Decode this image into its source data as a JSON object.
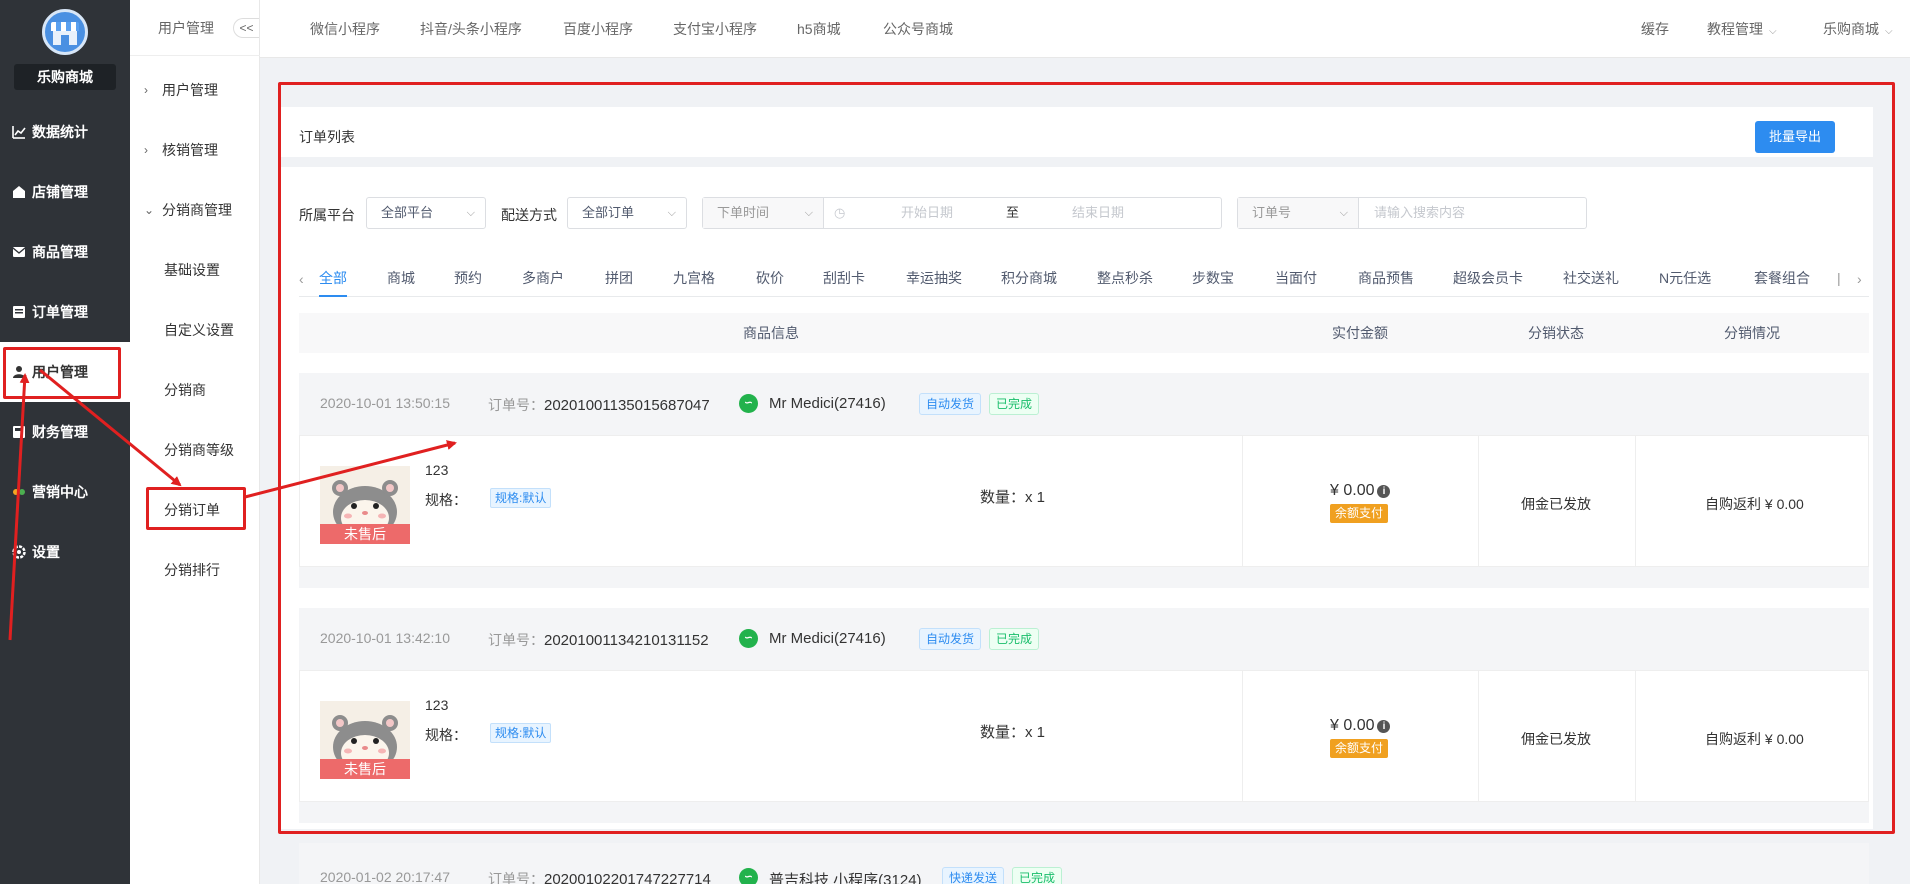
{
  "app": {
    "name": "乐购商城"
  },
  "sidebar": {
    "items": [
      {
        "label": "数据统计",
        "icon": "chart-icon"
      },
      {
        "label": "店铺管理",
        "icon": "store-icon"
      },
      {
        "label": "商品管理",
        "icon": "goods-icon"
      },
      {
        "label": "订单管理",
        "icon": "order-icon"
      },
      {
        "label": "用户管理",
        "icon": "user-icon"
      },
      {
        "label": "财务管理",
        "icon": "finance-icon"
      },
      {
        "label": "营销中心",
        "icon": "marketing-icon"
      },
      {
        "label": "设置",
        "icon": "gear-icon"
      }
    ]
  },
  "subsidebar": {
    "title": "用户管理",
    "collapse": "<<",
    "items": [
      "用户管理",
      "核销管理",
      "分销商管理",
      "基础设置",
      "自定义设置",
      "分销商",
      "分销商等级",
      "分销订单",
      "分销排行"
    ]
  },
  "topnav": {
    "tabs": [
      "微信小程序",
      "抖音/头条小程序",
      "百度小程序",
      "支付宝小程序",
      "h5商城",
      "公众号商城"
    ],
    "right": [
      "缓存",
      "教程管理",
      "乐购商城"
    ]
  },
  "card": {
    "title": "订单列表",
    "export": "批量导出"
  },
  "filters": {
    "platform_label": "所属平台",
    "platform_value": "全部平台",
    "delivery_label": "配送方式",
    "delivery_value": "全部订单",
    "time_type": "下单时间",
    "start_placeholder": "开始日期",
    "to": "至",
    "end_placeholder": "结束日期",
    "search_type": "订单号",
    "search_placeholder": "请输入搜索内容"
  },
  "tabs": [
    "全部",
    "商城",
    "预约",
    "多商户",
    "拼团",
    "九宫格",
    "砍价",
    "刮刮卡",
    "幸运抽奖",
    "积分商城",
    "整点秒杀",
    "步数宝",
    "当面付",
    "商品预售",
    "超级会员卡",
    "社交送礼",
    "N元任选",
    "套餐组合",
    "|"
  ],
  "table": {
    "headers": [
      "商品信息",
      "实付金额",
      "分销状态",
      "分销情况"
    ]
  },
  "orders": [
    {
      "time": "2020-10-01 13:50:15",
      "order_no_label": "订单号：",
      "order_no": "2020100113501568704",
      "order_no_tail": "7",
      "user": "Mr Medici(27416)",
      "tags": [
        "自动发货",
        "已完成"
      ],
      "after_sale": "未售后",
      "product": "123",
      "spec_label": "规格：",
      "spec": "规格:默认",
      "qty": "数量：x 1",
      "price": "¥ 0.00",
      "pay": "余额支付",
      "dist_status": "佣金已发放",
      "dist_info": "自购返利 ¥ 0.00"
    },
    {
      "time": "2020-10-01 13:42:10",
      "order_no_label": "订单号：",
      "order_no": "2020100113421013115",
      "order_no_tail": "2",
      "user": "Mr Medici(27416)",
      "tags": [
        "自动发货",
        "已完成"
      ],
      "after_sale": "未售后",
      "product": "123",
      "spec_label": "规格：",
      "spec": "规格:默认",
      "qty": "数量：x 1",
      "price": "¥ 0.00",
      "pay": "余额支付",
      "dist_status": "佣金已发放",
      "dist_info": "自购返利 ¥ 0.00"
    },
    {
      "time": "2020-01-02 20:17:47",
      "order_no_label": "订单号：",
      "order_no": "2020010220174722771",
      "order_no_tail": "4",
      "user": "普吉科技 小程序(3124)",
      "tags": [
        "快递发送",
        "已完成"
      ]
    }
  ],
  "colors": {
    "sidebar": "#2f3338",
    "accent": "#2d8cf0",
    "annotation": "#e02020"
  }
}
